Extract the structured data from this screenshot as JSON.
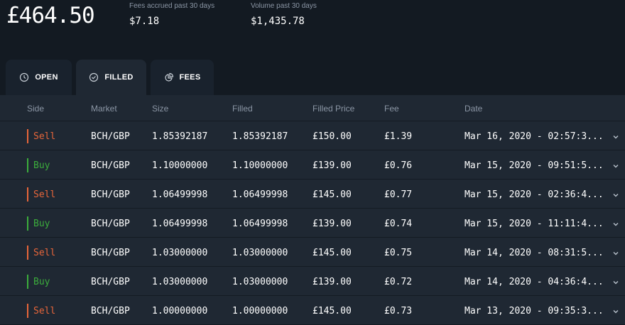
{
  "balance": "£464.50",
  "fees_stat": {
    "label": "Fees accrued past 30 days",
    "value": "$7.18"
  },
  "volume_stat": {
    "label": "Volume past 30 days",
    "value": "$1,435.78"
  },
  "tabs": [
    {
      "label": "OPEN",
      "icon": "clock-icon",
      "active": false
    },
    {
      "label": "FILLED",
      "icon": "check-circle-icon",
      "active": true
    },
    {
      "label": "FEES",
      "icon": "pie-chart-icon",
      "active": false
    }
  ],
  "columns": {
    "side": "Side",
    "market": "Market",
    "size": "Size",
    "filled": "Filled",
    "filled_price": "Filled Price",
    "fee": "Fee",
    "date": "Date"
  },
  "colors": {
    "sell": "#e8663a",
    "buy": "#3cad3c",
    "background": "#131a22",
    "panel": "#1f2833"
  },
  "rows": [
    {
      "side": "Sell",
      "market": "BCH/GBP",
      "size": "1.85392187",
      "filled": "1.85392187",
      "filled_price": "£150.00",
      "fee": "£1.39",
      "date": "Mar 16, 2020 - 02:57:3..."
    },
    {
      "side": "Buy",
      "market": "BCH/GBP",
      "size": "1.10000000",
      "filled": "1.10000000",
      "filled_price": "£139.00",
      "fee": "£0.76",
      "date": "Mar 15, 2020 - 09:51:5..."
    },
    {
      "side": "Sell",
      "market": "BCH/GBP",
      "size": "1.06499998",
      "filled": "1.06499998",
      "filled_price": "£145.00",
      "fee": "£0.77",
      "date": "Mar 15, 2020 - 02:36:4..."
    },
    {
      "side": "Buy",
      "market": "BCH/GBP",
      "size": "1.06499998",
      "filled": "1.06499998",
      "filled_price": "£139.00",
      "fee": "£0.74",
      "date": "Mar 15, 2020 - 11:11:4..."
    },
    {
      "side": "Sell",
      "market": "BCH/GBP",
      "size": "1.03000000",
      "filled": "1.03000000",
      "filled_price": "£145.00",
      "fee": "£0.75",
      "date": "Mar 14, 2020 - 08:31:5..."
    },
    {
      "side": "Buy",
      "market": "BCH/GBP",
      "size": "1.03000000",
      "filled": "1.03000000",
      "filled_price": "£139.00",
      "fee": "£0.72",
      "date": "Mar 14, 2020 - 04:36:4..."
    },
    {
      "side": "Sell",
      "market": "BCH/GBP",
      "size": "1.00000000",
      "filled": "1.00000000",
      "filled_price": "£145.00",
      "fee": "£0.73",
      "date": "Mar 13, 2020 - 09:35:3..."
    }
  ]
}
